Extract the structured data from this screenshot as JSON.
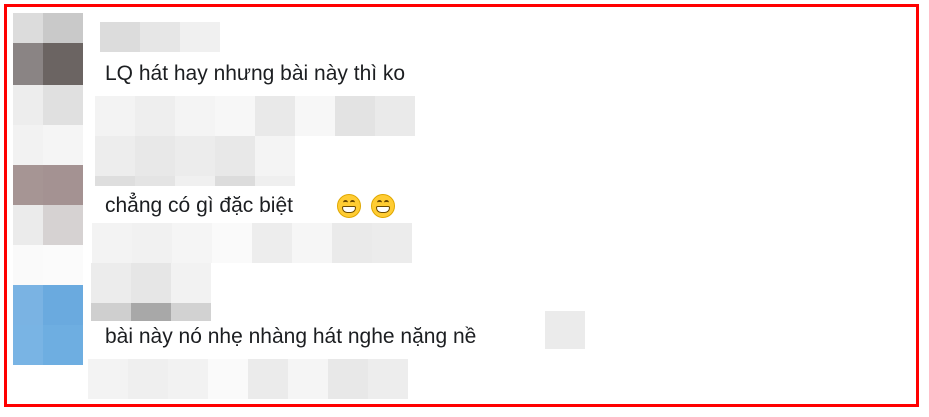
{
  "comments": [
    {
      "text": "LQ hát hay nhưng bài này thì ko"
    },
    {
      "text": "chẳng có gì đặc biệt"
    },
    {
      "text": "bài này nó nhẹ nhàng hát nghe nặng nề"
    }
  ],
  "emoji_icons": [
    "grinning-face-icon",
    "grinning-face-icon"
  ],
  "colors": {
    "border": "#ff0000",
    "text": "#1c1e21",
    "avatar_blue": "#6aaadf"
  }
}
